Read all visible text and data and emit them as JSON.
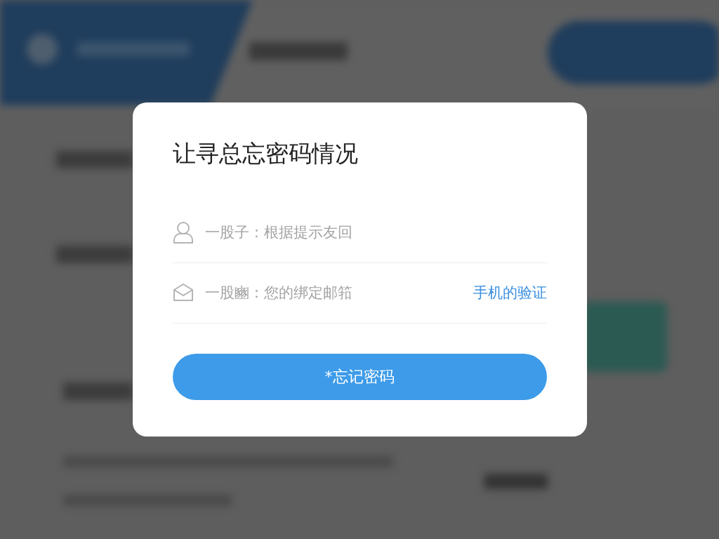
{
  "dialog": {
    "title": "让寻总忘密码情况",
    "fields": [
      {
        "kind": "user",
        "placeholder": "一股子：根据提示友回"
      },
      {
        "kind": "mail",
        "placeholder": "一股豳：您的绑定邮筘",
        "link": "手机的验证"
      }
    ],
    "button": "*忘记密码"
  }
}
